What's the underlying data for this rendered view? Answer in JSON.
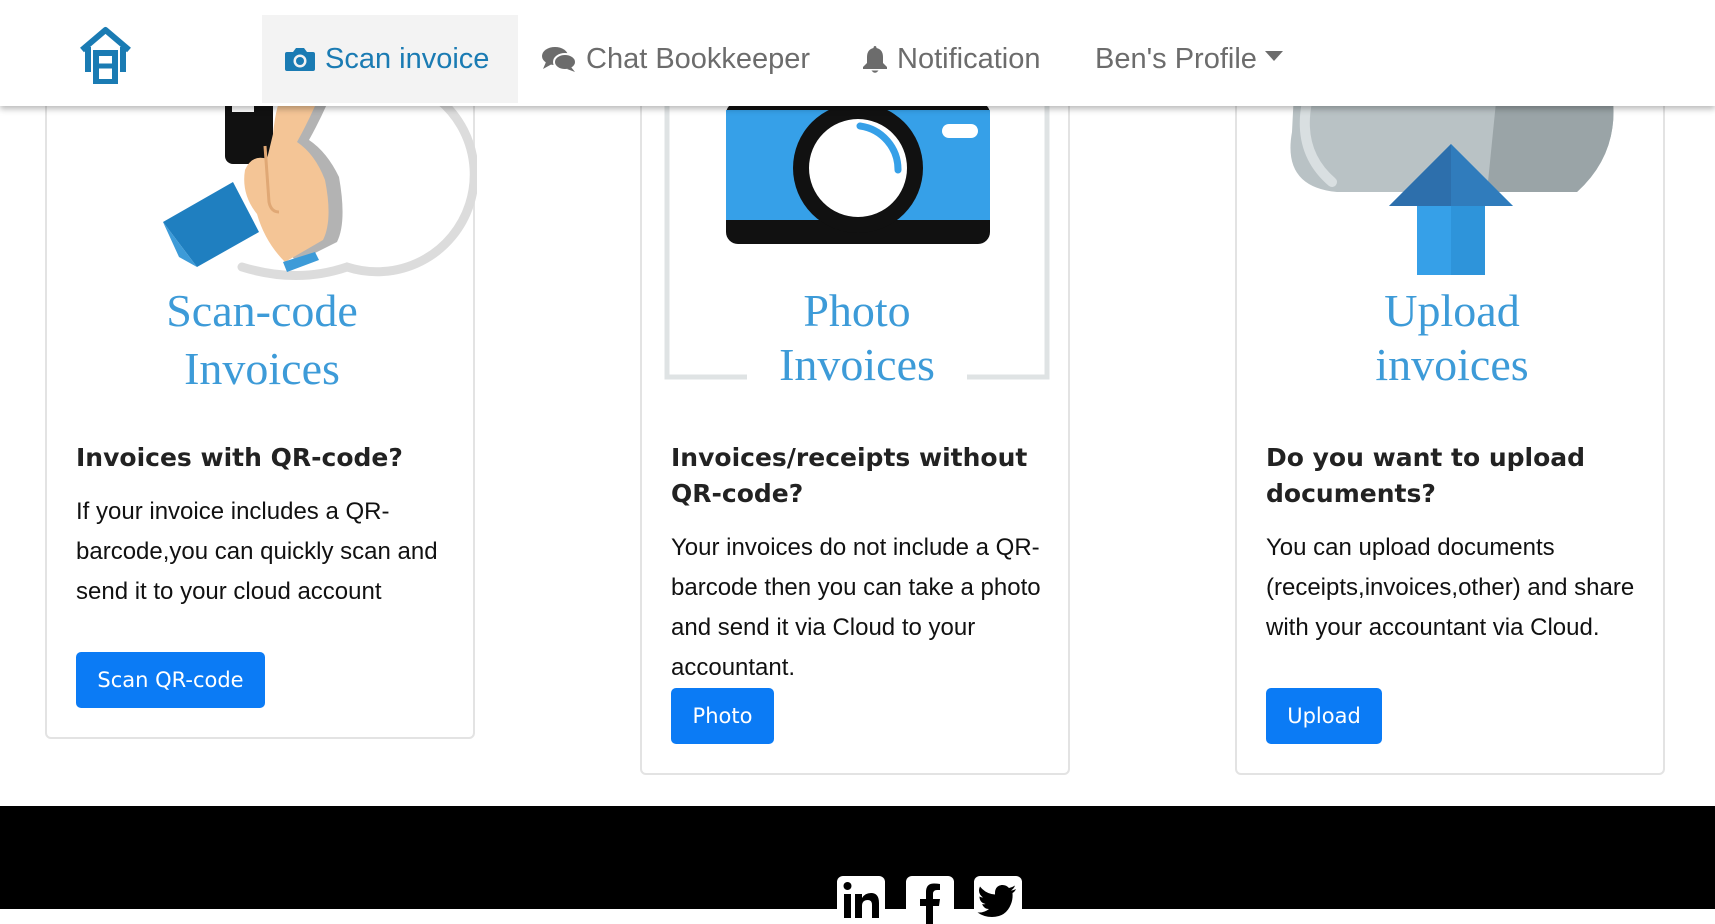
{
  "nav": {
    "scan_invoice": "Scan invoice",
    "chat_bookkeeper": "Chat Bookkeeper",
    "notification": "Notification",
    "profile": "Ben's Profile"
  },
  "cards": [
    {
      "title_line1": "Scan-code",
      "title_line2": "Invoices",
      "heading": "Invoices with QR-code?",
      "description": "If your invoice includes a QR-barcode,you can quickly scan and send it to your cloud account",
      "button": "Scan QR-code"
    },
    {
      "title_line1": "Photo",
      "title_line2": "Invoices",
      "heading": "Invoices/receipts without QR-code?",
      "description": "Your invoices do not include a QR-barcode then you can take a photo and send it via Cloud to your accountant.",
      "button": "Photo"
    },
    {
      "title_line1": "Upload",
      "title_line2": "invoices",
      "heading": "Do you want to upload documents?",
      "description": "You can upload documents (receipts,invoices,other) and share with your accountant via Cloud.",
      "button": "Upload"
    }
  ],
  "colors": {
    "accent_blue": "#0b7bf5",
    "title_blue": "#3d9bd8",
    "nav_active": "#1a7bb3",
    "footer_bg": "#000000"
  },
  "icons": [
    "home-logo-icon",
    "camera-icon",
    "comments-icon",
    "bell-icon",
    "linkedin-icon",
    "facebook-icon",
    "twitter-icon"
  ]
}
